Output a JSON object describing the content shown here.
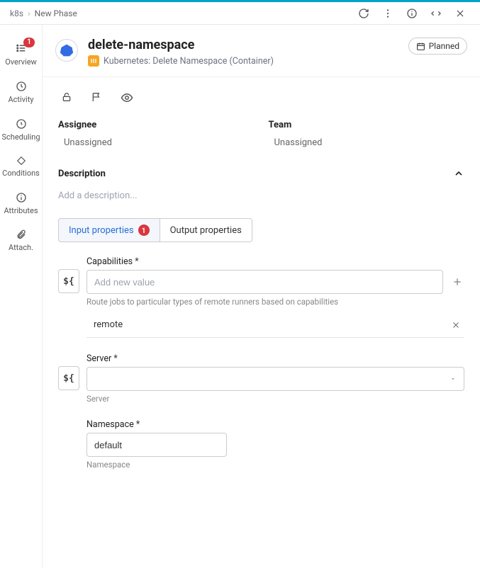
{
  "breadcrumb": {
    "root": "k8s",
    "current": "New Phase"
  },
  "header": {
    "title": "delete-namespace",
    "subtitle": "Kubernetes: Delete Namespace (Container)",
    "status": "Planned"
  },
  "sidebar": {
    "overview": {
      "label": "Overview",
      "badge": "1"
    },
    "activity": {
      "label": "Activity"
    },
    "scheduling": {
      "label": "Scheduling"
    },
    "conditions": {
      "label": "Conditions"
    },
    "attributes": {
      "label": "Attributes"
    },
    "attach": {
      "label": "Attach."
    }
  },
  "assignee": {
    "label": "Assignee",
    "value": "Unassigned"
  },
  "team": {
    "label": "Team",
    "value": "Unassigned"
  },
  "description": {
    "label": "Description",
    "placeholder": "Add a description..."
  },
  "tabs": {
    "input": {
      "label": "Input properties",
      "badge": "1"
    },
    "output": {
      "label": "Output properties"
    }
  },
  "fields": {
    "capabilities": {
      "label": "Capabilities",
      "placeholder": "Add new value",
      "help": "Route jobs to particular types of remote runners based on capabilities",
      "values": [
        "remote"
      ]
    },
    "server": {
      "label": "Server",
      "help": "Server",
      "value": ""
    },
    "namespace": {
      "label": "Namespace",
      "help": "Namespace",
      "value": "default"
    }
  },
  "var_token": "${"
}
